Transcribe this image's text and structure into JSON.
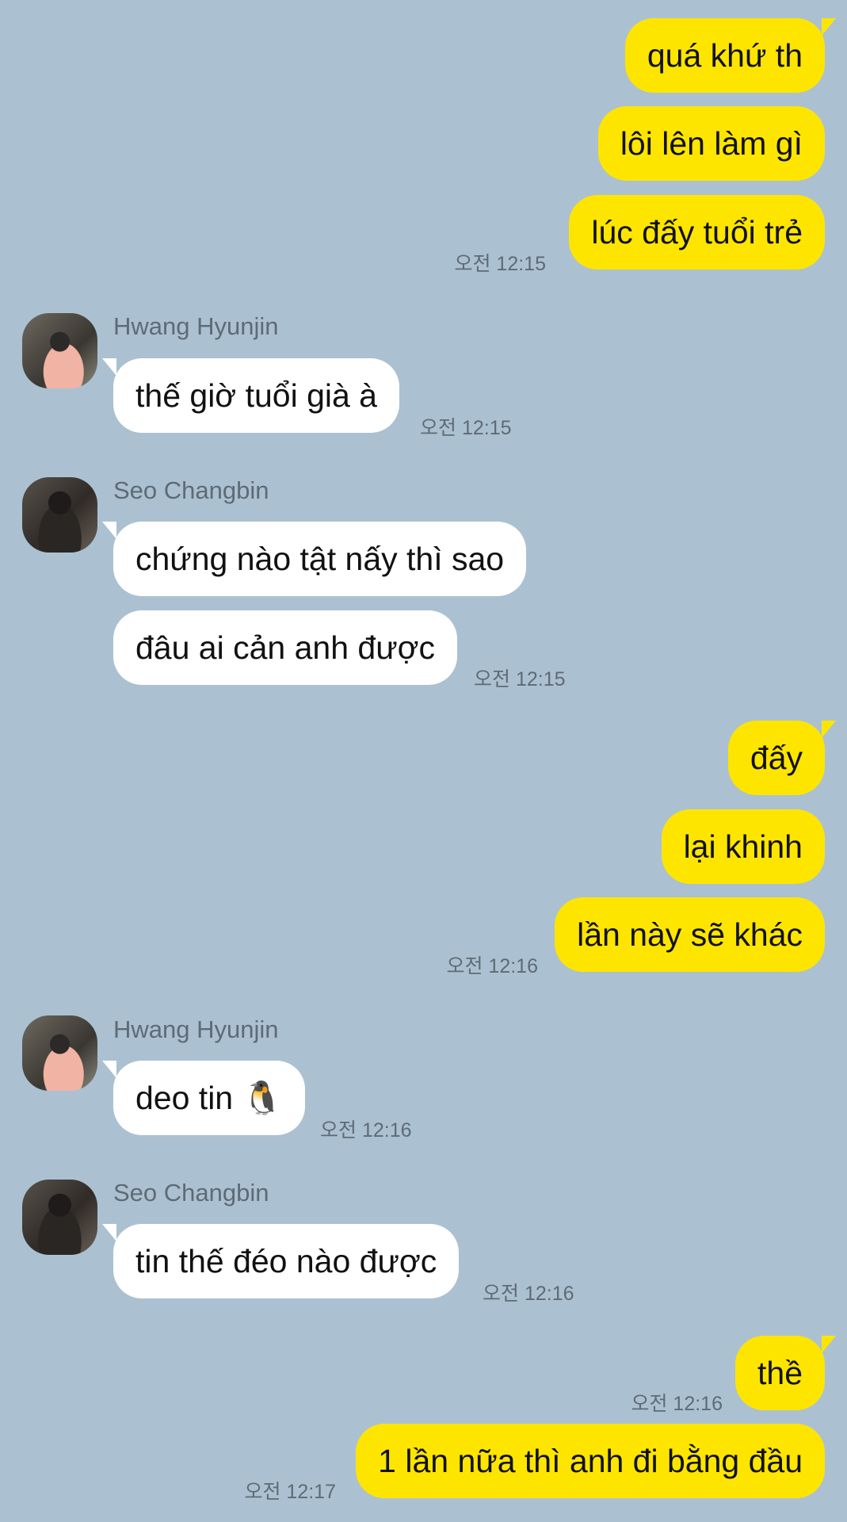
{
  "colors": {
    "background": "#abc1d1",
    "my_bubble": "#fee500",
    "their_bubble": "#ffffff"
  },
  "messages": {
    "m1": "quá khứ th",
    "m2": "lôi lên làm gì",
    "m3": "lúc đấy tuổi trẻ",
    "t1": "오전 12:15",
    "s1": "Hwang Hyunjin",
    "m4": "thế giờ tuổi già à",
    "t2": "오전 12:15",
    "s2": "Seo Changbin",
    "m5": "chứng nào tật nấy thì sao",
    "m6": "đâu ai cản anh được",
    "t3": "오전 12:15",
    "m7": "đấy",
    "m8": "lại khinh",
    "m9": "lần này sẽ khác",
    "t4": "오전 12:16",
    "s3": "Hwang Hyunjin",
    "m10": "deo tin 🐧",
    "t5": "오전 12:16",
    "s4": "Seo Changbin",
    "m11": "tin thế đéo nào được",
    "t6": "오전 12:16",
    "m12": "thề",
    "t7": "오전 12:16",
    "m13": "1 lần nữa thì anh đi bằng đầu",
    "t8": "오전 12:17"
  }
}
